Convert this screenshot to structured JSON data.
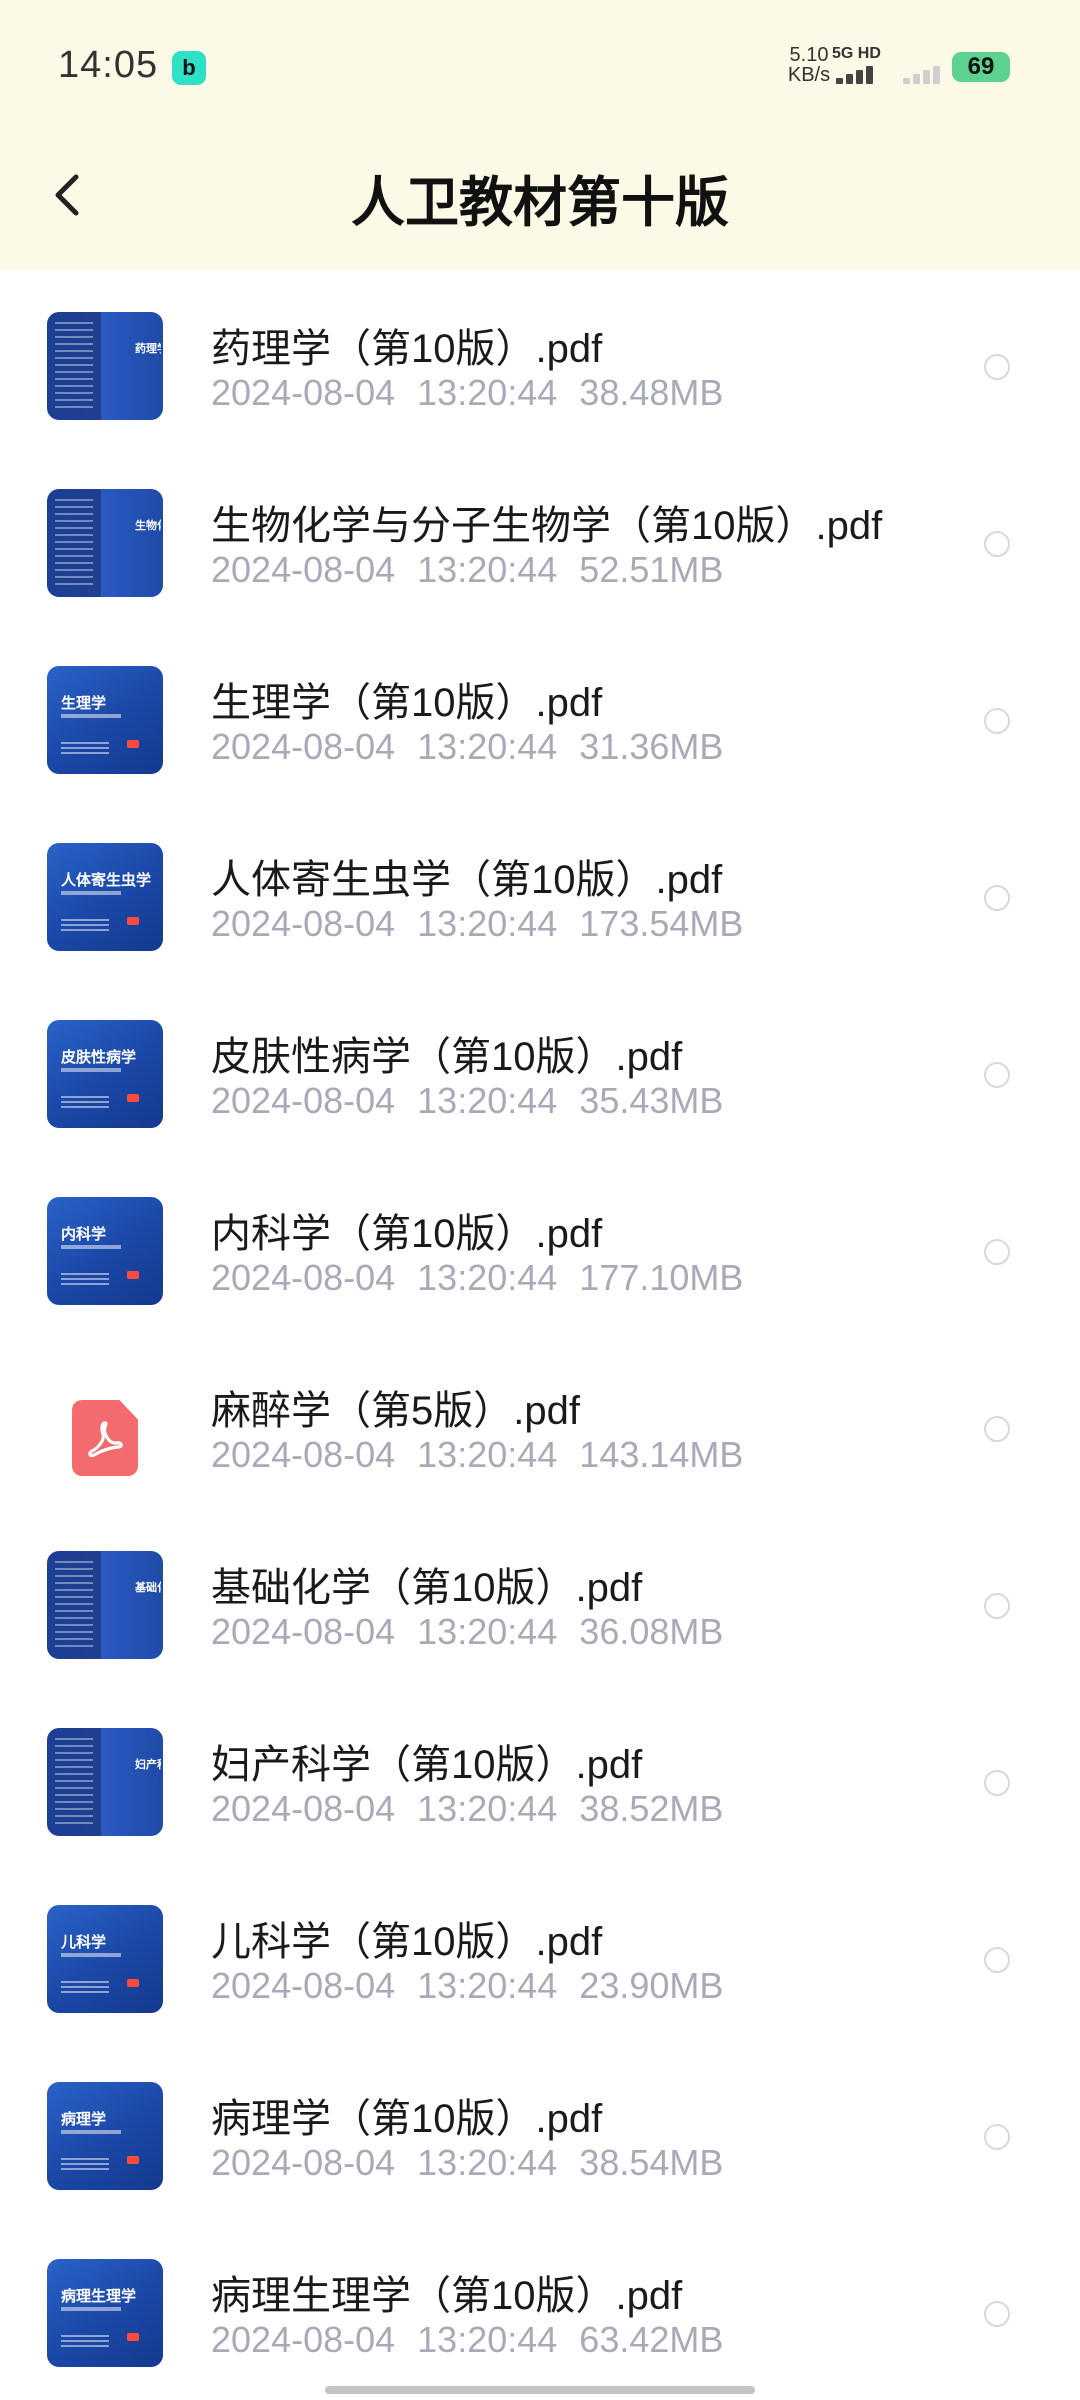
{
  "status_bar": {
    "time": "14:05",
    "app_badge": "b",
    "net_speed_value": "5.10",
    "net_speed_unit": "KB/s",
    "network_type": "5G HD",
    "battery": "69"
  },
  "header": {
    "title": "人卫教材第十版"
  },
  "files": [
    {
      "name": "药理学（第10版）.pdf",
      "date": "2024-08-04",
      "time": "13:20:44",
      "size": "38.48MB",
      "thumb": "spine",
      "cover_label": "药理学"
    },
    {
      "name": "生物化学与分子生物学（第10版）.pdf",
      "date": "2024-08-04",
      "time": "13:20:44",
      "size": "52.51MB",
      "thumb": "spine",
      "cover_label": "生物化"
    },
    {
      "name": "生理学（第10版）.pdf",
      "date": "2024-08-04",
      "time": "13:20:44",
      "size": "31.36MB",
      "thumb": "blue",
      "cover_label": "生理学"
    },
    {
      "name": "人体寄生虫学（第10版）.pdf",
      "date": "2024-08-04",
      "time": "13:20:44",
      "size": "173.54MB",
      "thumb": "blue",
      "cover_label": "人体寄生虫学"
    },
    {
      "name": "皮肤性病学（第10版）.pdf",
      "date": "2024-08-04",
      "time": "13:20:44",
      "size": "35.43MB",
      "thumb": "blue",
      "cover_label": "皮肤性病学"
    },
    {
      "name": "内科学（第10版）.pdf",
      "date": "2024-08-04",
      "time": "13:20:44",
      "size": "177.10MB",
      "thumb": "blue",
      "cover_label": "内科学"
    },
    {
      "name": "麻醉学（第5版）.pdf",
      "date": "2024-08-04",
      "time": "13:20:44",
      "size": "143.14MB",
      "thumb": "pdf",
      "cover_label": ""
    },
    {
      "name": "基础化学（第10版）.pdf",
      "date": "2024-08-04",
      "time": "13:20:44",
      "size": "36.08MB",
      "thumb": "spine",
      "cover_label": "基础化"
    },
    {
      "name": "妇产科学（第10版）.pdf",
      "date": "2024-08-04",
      "time": "13:20:44",
      "size": "38.52MB",
      "thumb": "spine",
      "cover_label": "妇产科"
    },
    {
      "name": "儿科学（第10版）.pdf",
      "date": "2024-08-04",
      "time": "13:20:44",
      "size": "23.90MB",
      "thumb": "blue",
      "cover_label": "儿科学"
    },
    {
      "name": "病理学（第10版）.pdf",
      "date": "2024-08-04",
      "time": "13:20:44",
      "size": "38.54MB",
      "thumb": "blue",
      "cover_label": "病理学"
    },
    {
      "name": "病理生理学（第10版）.pdf",
      "date": "2024-08-04",
      "time": "13:20:44",
      "size": "63.42MB",
      "thumb": "blue",
      "cover_label": "病理生理学"
    }
  ]
}
